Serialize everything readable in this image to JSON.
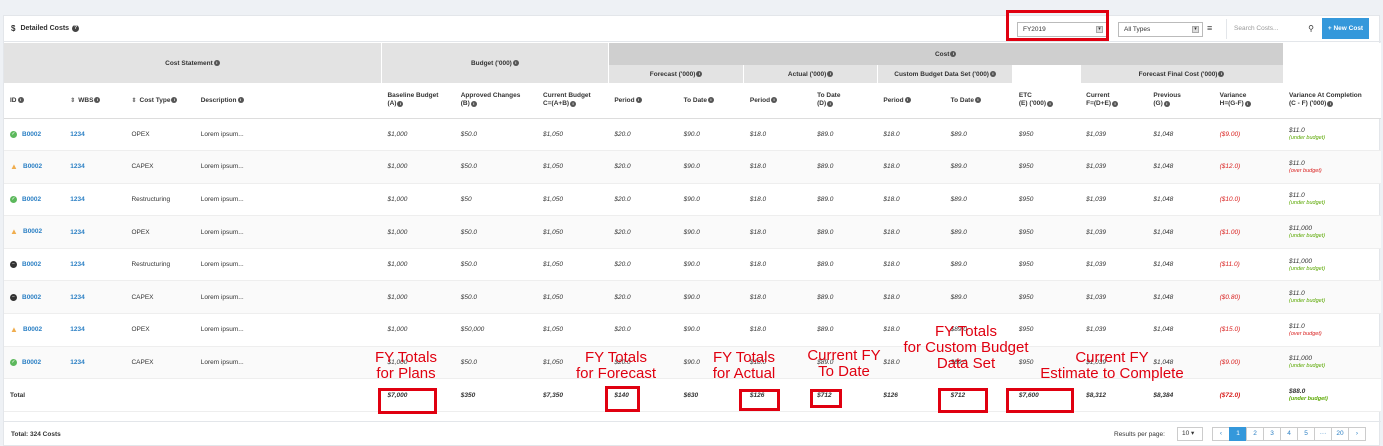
{
  "toolbar": {
    "title": "Detailed Costs",
    "currency_icon": "$",
    "year_select": "FY2019",
    "type_select": "All Types",
    "search_placeholder": "Search Costs...",
    "new_button": "New Cost"
  },
  "header": {
    "cost_statement": "Cost Statement",
    "budget": "Budget ('000)",
    "cost": "Cost",
    "forecast": "Forecast ('000)",
    "actual": "Actual ('000)",
    "custom": "Custom Budget Data Set ('000)",
    "final": "Forecast Final Cost ('000)",
    "columns": {
      "id": "ID",
      "wbs": "WBS",
      "cost_type": "Cost Type",
      "description": "Description",
      "baseline": "Baseline Budget",
      "baseline_sub": "(A)",
      "approved": "Approved Changes",
      "approved_sub": "(B)",
      "current_budget": "Current Budget",
      "current_budget_sub": "C=(A+B)",
      "fc_period": "Period",
      "fc_todate": "To Date",
      "ac_period": "Period",
      "ac_todate": "To Date",
      "ac_todate_sub": "(D)",
      "cb_period": "Period",
      "cb_todate": "To Date",
      "etc": "ETC",
      "etc_sub": "(E) ('000)",
      "ffc_current": "Current",
      "ffc_current_sub": "F=(D+E)",
      "ffc_previous": "Previous",
      "ffc_previous_sub": "(G)",
      "variance": "Variance",
      "variance_sub": "H=(G-F)",
      "vac": "Variance At Completion",
      "vac_sub": "(C - F) ('000)"
    }
  },
  "rows": [
    {
      "status": "ok",
      "id": "B0002",
      "wbs": "1234",
      "type": "OPEX",
      "desc": "Lorem ipsum...",
      "baseline": "$1,000",
      "approved": "$50.0",
      "current_budget": "$1,050",
      "fc_period": "$20.0",
      "fc_todate": "$90.0",
      "ac_period": "$18.0",
      "ac_todate": "$89.0",
      "cb_period": "$18.0",
      "cb_todate": "$89.0",
      "etc": "$950",
      "ffc_current": "$1,039",
      "ffc_previous": "$1,048",
      "variance": "($9.00)",
      "vac": "$11.0",
      "vac_note": "(under budget)",
      "vac_state": "under"
    },
    {
      "status": "warn",
      "id": "B0002",
      "wbs": "1234",
      "type": "CAPEX",
      "desc": "Lorem ipsum...",
      "baseline": "$1,000",
      "approved": "$50.0",
      "current_budget": "$1,050",
      "fc_period": "$20.0",
      "fc_todate": "$90.0",
      "ac_period": "$18.0",
      "ac_todate": "$89.0",
      "cb_period": "$18.0",
      "cb_todate": "$89.0",
      "etc": "$950",
      "ffc_current": "$1,039",
      "ffc_previous": "$1,048",
      "variance": "($12.0)",
      "vac": "$11.0",
      "vac_note": "(over budget)",
      "vac_state": "over"
    },
    {
      "status": "ok",
      "id": "B0002",
      "wbs": "1234",
      "type": "Restructuring",
      "desc": "Lorem ipsum...",
      "baseline": "$1,000",
      "approved": "$50",
      "current_budget": "$1,050",
      "fc_period": "$20.0",
      "fc_todate": "$90.0",
      "ac_period": "$18.0",
      "ac_todate": "$89.0",
      "cb_period": "$18.0",
      "cb_todate": "$89.0",
      "etc": "$950",
      "ffc_current": "$1,039",
      "ffc_previous": "$1,048",
      "variance": "($10.0)",
      "vac": "$11.0",
      "vac_note": "(under budget)",
      "vac_state": "under"
    },
    {
      "status": "warn",
      "id": "B0002",
      "wbs": "1234",
      "type": "OPEX",
      "desc": "Lorem ipsum...",
      "baseline": "$1,000",
      "approved": "$50.0",
      "current_budget": "$1,050",
      "fc_period": "$20.0",
      "fc_todate": "$90.0",
      "ac_period": "$18.0",
      "ac_todate": "$89.0",
      "cb_period": "$18.0",
      "cb_todate": "$89.0",
      "etc": "$950",
      "ffc_current": "$1,039",
      "ffc_previous": "$1,048",
      "variance": "($1.00)",
      "vac": "$11,000",
      "vac_note": "(under budget)",
      "vac_state": "under"
    },
    {
      "status": "stop",
      "id": "B0002",
      "wbs": "1234",
      "type": "Restructuring",
      "desc": "Lorem ipsum...",
      "baseline": "$1,000",
      "approved": "$50.0",
      "current_budget": "$1,050",
      "fc_period": "$20.0",
      "fc_todate": "$90.0",
      "ac_period": "$18.0",
      "ac_todate": "$89.0",
      "cb_period": "$18.0",
      "cb_todate": "$89.0",
      "etc": "$950",
      "ffc_current": "$1,039",
      "ffc_previous": "$1,048",
      "variance": "($11.0)",
      "vac": "$11,000",
      "vac_note": "(under budget)",
      "vac_state": "under"
    },
    {
      "status": "stop",
      "id": "B0002",
      "wbs": "1234",
      "type": "CAPEX",
      "desc": "Lorem ipsum...",
      "baseline": "$1,000",
      "approved": "$50.0",
      "current_budget": "$1,050",
      "fc_period": "$20.0",
      "fc_todate": "$90.0",
      "ac_period": "$18.0",
      "ac_todate": "$89.0",
      "cb_period": "$18.0",
      "cb_todate": "$89.0",
      "etc": "$950",
      "ffc_current": "$1,039",
      "ffc_previous": "$1,048",
      "variance": "($0.80)",
      "vac": "$11.0",
      "vac_note": "(under budget)",
      "vac_state": "under"
    },
    {
      "status": "warn",
      "id": "B0002",
      "wbs": "1234",
      "type": "OPEX",
      "desc": "Lorem ipsum...",
      "baseline": "$1,000",
      "approved": "$50,000",
      "current_budget": "$1,050",
      "fc_period": "$20.0",
      "fc_todate": "$90.0",
      "ac_period": "$18.0",
      "ac_todate": "$89.0",
      "cb_period": "$18.0",
      "cb_todate": "$89.0",
      "etc": "$950",
      "ffc_current": "$1,039",
      "ffc_previous": "$1,048",
      "variance": "($15.0)",
      "vac": "$11.0",
      "vac_note": "(over budget)",
      "vac_state": "over"
    },
    {
      "status": "ok",
      "id": "B0002",
      "wbs": "1234",
      "type": "CAPEX",
      "desc": "Lorem ipsum...",
      "baseline": "$1,000",
      "approved": "$50.0",
      "current_budget": "$1,050",
      "fc_period": "$20.0",
      "fc_todate": "$90.0",
      "ac_period": "$18.0",
      "ac_todate": "$89.0",
      "cb_period": "$18.0",
      "cb_todate": "$89.0",
      "etc": "$950",
      "ffc_current": "$1,039",
      "ffc_previous": "$1,048",
      "variance": "($9.00)",
      "vac": "$11,000",
      "vac_note": "(under budget)",
      "vac_state": "under"
    }
  ],
  "totals": {
    "label": "Total",
    "baseline": "$7,000",
    "approved": "$350",
    "current_budget": "$7,350",
    "fc_period": "$140",
    "fc_todate": "$630",
    "ac_period": "$126",
    "ac_todate": "$712",
    "cb_period": "$126",
    "cb_todate": "$712",
    "etc": "$7,600",
    "ffc_current": "$8,312",
    "ffc_previous": "$8,384",
    "variance": "($72.0)",
    "vac": "$88.0",
    "vac_note": "(under budget)"
  },
  "footer": {
    "total_costs": "Total: 324 Costs",
    "results_label": "Results per page:",
    "per_page": "10",
    "pages": [
      "1",
      "2",
      "3",
      "4",
      "5",
      "···",
      "20"
    ],
    "prev": "‹",
    "next": "›"
  },
  "annotations": {
    "plans": [
      "FY Totals",
      "for Plans"
    ],
    "forecast": [
      "FY Totals",
      "for Forecast"
    ],
    "actual": [
      "FY Totals",
      "for Actual"
    ],
    "todate": [
      "Current FY",
      "To Date"
    ],
    "custom": [
      "FY Totals",
      "for Custom Budget",
      "Data Set"
    ],
    "etc": [
      "Current FY",
      "Estimate to Complete"
    ]
  },
  "colors": {
    "accent": "#3498db",
    "annotation_red": "#e00010",
    "negative": "#d9201f",
    "under_budget": "#5aa800"
  }
}
